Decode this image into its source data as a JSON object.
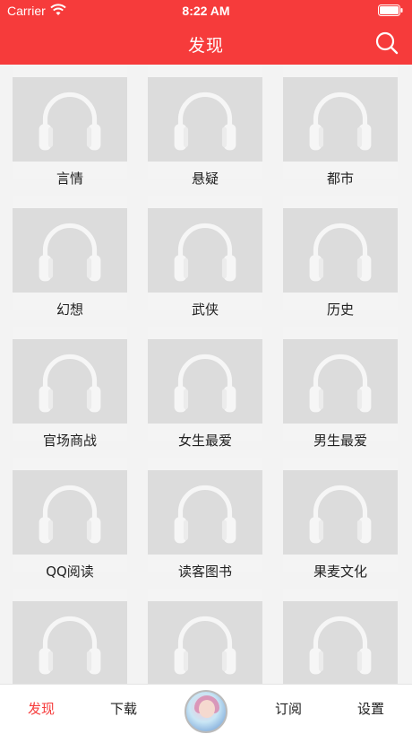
{
  "status_bar": {
    "carrier": "Carrier",
    "time": "8:22 AM"
  },
  "header": {
    "title": "发现",
    "search_icon": "search-icon"
  },
  "colors": {
    "accent": "#f63b3b",
    "placeholder": "#dcdcdc"
  },
  "categories": [
    {
      "label": "言情"
    },
    {
      "label": "悬疑"
    },
    {
      "label": "都市"
    },
    {
      "label": "幻想"
    },
    {
      "label": "武侠"
    },
    {
      "label": "历史"
    },
    {
      "label": "官场商战"
    },
    {
      "label": "女生最爱"
    },
    {
      "label": "男生最爱"
    },
    {
      "label": "QQ阅读"
    },
    {
      "label": "读客图书"
    },
    {
      "label": "果麦文化"
    },
    {
      "label": ""
    },
    {
      "label": ""
    },
    {
      "label": ""
    }
  ],
  "tabbar": {
    "tabs": [
      {
        "label": "发现",
        "active": true
      },
      {
        "label": "下载",
        "active": false
      },
      {
        "label": "订阅",
        "active": false
      },
      {
        "label": "设置",
        "active": false
      }
    ]
  }
}
